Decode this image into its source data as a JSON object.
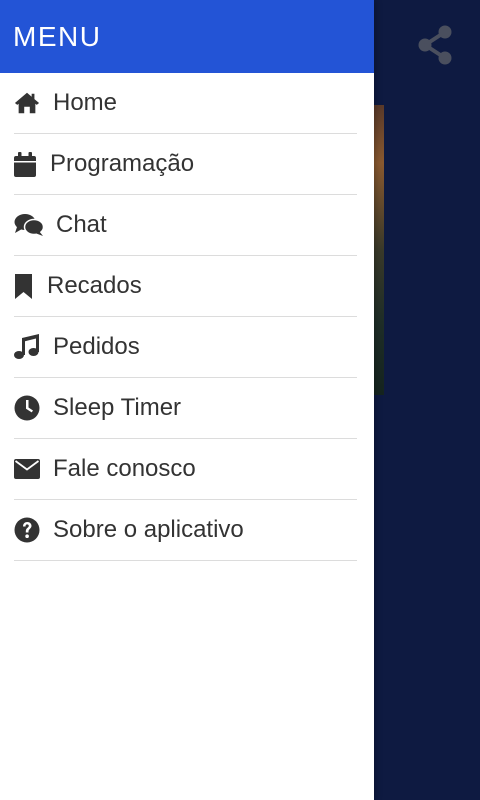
{
  "drawer": {
    "title": "MENU",
    "items": [
      {
        "label": "Home",
        "icon": "home-icon"
      },
      {
        "label": "Programação",
        "icon": "calendar-icon"
      },
      {
        "label": "Chat",
        "icon": "chat-icon"
      },
      {
        "label": "Recados",
        "icon": "bookmark-icon"
      },
      {
        "label": "Pedidos",
        "icon": "music-note-icon"
      },
      {
        "label": "Sleep Timer",
        "icon": "clock-icon"
      },
      {
        "label": "Fale conosco",
        "icon": "envelope-icon"
      },
      {
        "label": "Sobre o aplicativo",
        "icon": "question-circle-icon"
      }
    ]
  },
  "header": {
    "share_icon": "share-icon"
  },
  "colors": {
    "header_bg": "#2354d6",
    "app_bg": "#0e1a41",
    "icon": "#333333",
    "share_icon": "#4a4f5e"
  }
}
